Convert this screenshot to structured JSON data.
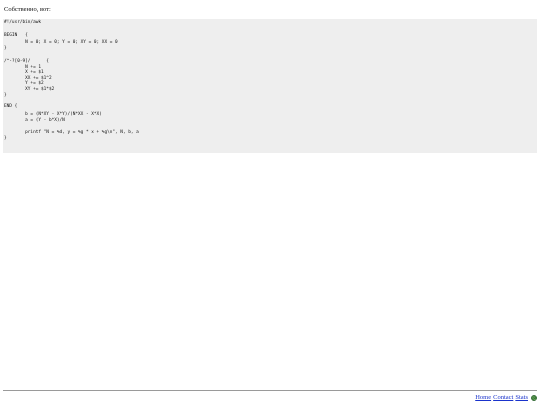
{
  "intro_text": "Собственно, вот:",
  "code_lines": [
    "#!/usr/bin/awk",
    "",
    "BEGIN   {",
    "        N = 0; X = 0; Y = 0; XY = 0; XX = 0",
    "}",
    "",
    "/^-?[0-9]/      {",
    "        N += 1",
    "        X += $1",
    "        XX += $1^2",
    "        Y += $2",
    "        XY += $1*$2",
    "}",
    "",
    "END {",
    "        b = (N*XY - X*Y)/(N*XX - X*X)",
    "        a = (Y - b*X)/N",
    "",
    "        printf \"N = %d, y = %g * x + %g\\n\", N, b, a",
    "}"
  ],
  "footer": {
    "home_label": "Home",
    "contact_label": "Contact",
    "stats_label": "Stats",
    "stats_icon": "globe-icon"
  },
  "colors": {
    "code_background": "#eeeeee",
    "link": "#1a33cc",
    "rule": "#9a9a9a"
  }
}
